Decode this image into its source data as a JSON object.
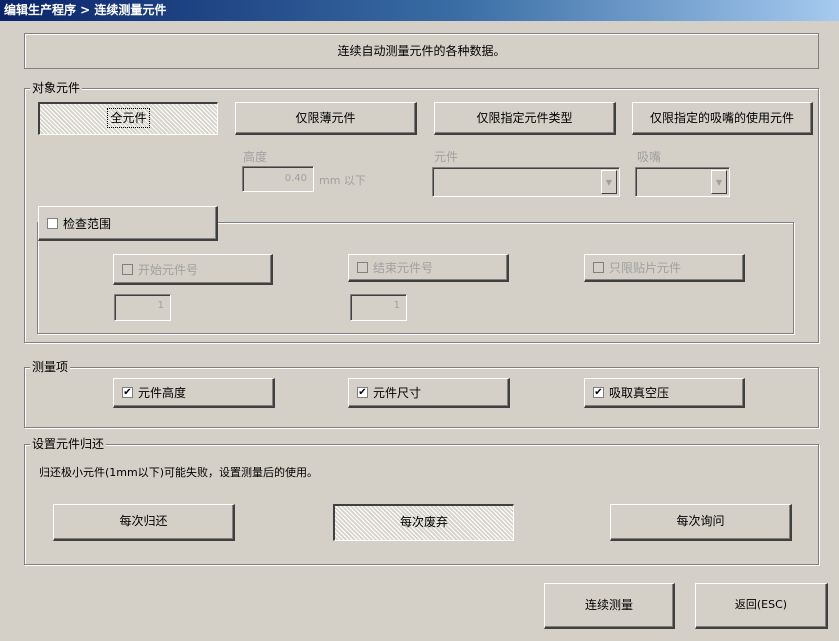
{
  "window": {
    "title": "编辑生产程序 > 连续测量元件"
  },
  "banner": {
    "text": "连续自动测量元件的各种数据。"
  },
  "target_group": {
    "legend": "对象元件",
    "buttons": {
      "all": "全元件",
      "thin": "仅限薄元件",
      "type": "仅限指定元件类型",
      "nozzle": "仅限指定的吸嘴的使用元件"
    },
    "height_label": "高度",
    "height_value": "0.40",
    "height_unit": "mm 以下",
    "part_label": "元件",
    "nozzle_label": "吸嘴",
    "range_check": {
      "label": "检查范围",
      "checked": false
    },
    "start_no": {
      "label": "开始元件号",
      "value": "1"
    },
    "end_no": {
      "label": "结束元件号",
      "value": "1"
    },
    "chip_only": {
      "label": "只限贴片元件"
    }
  },
  "measure_group": {
    "legend": "测量项",
    "height": {
      "label": "元件高度",
      "checked": true
    },
    "size": {
      "label": "元件尺寸",
      "checked": true
    },
    "vacuum": {
      "label": "吸取真空压",
      "checked": true
    }
  },
  "return_group": {
    "legend": "设置元件归还",
    "note": "归还极小元件(1mm以下)可能失败，设置测量后的使用。",
    "buttons": {
      "each_return": "每次归还",
      "each_discard": "每次废弃",
      "each_ask": "每次询问"
    }
  },
  "footer": {
    "continue": "连续测量",
    "back": "返回(ESC)"
  },
  "check_mark": "✔",
  "icons": {
    "dropdown": "▼"
  }
}
